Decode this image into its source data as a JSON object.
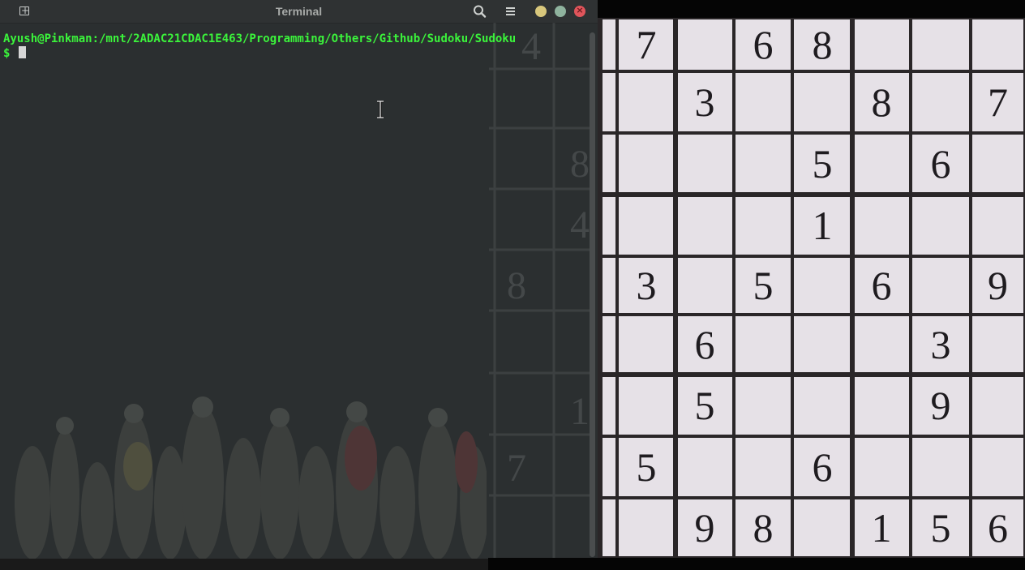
{
  "terminal": {
    "title": "Terminal",
    "prompt_path": "Ayush@Pinkman:/mnt/2ADAC21CDAC1E463/Programming/Others/Github/Sudoku/Sudoku",
    "prompt_symbol": "$",
    "icons": {
      "new_tab": "new-tab-icon",
      "search": "search-icon",
      "menu": "hamburger-menu-icon",
      "minimize": "minimize-icon",
      "maximize": "maximize-icon",
      "close": "close-icon"
    },
    "colors": {
      "prompt": "#3bf43b",
      "background": "#2b2f30",
      "close": "#e0555b",
      "minimize": "#d8c77c",
      "maximize": "#8fb39e"
    }
  },
  "background_sudoku_digits": [
    "4",
    "8",
    "4",
    "8",
    "1",
    "7"
  ],
  "sudoku_photo": {
    "rows": [
      [
        "7",
        "",
        "6",
        "8",
        "",
        "",
        ""
      ],
      [
        "",
        "3",
        "",
        "",
        "8",
        "",
        "7"
      ],
      [
        "",
        "",
        "",
        "5",
        "",
        "6",
        ""
      ],
      [
        "",
        "",
        "",
        "1",
        "",
        "",
        ""
      ],
      [
        "3",
        "",
        "5",
        "",
        "6",
        "",
        "9"
      ],
      [
        "",
        "6",
        "",
        "",
        "",
        "3",
        ""
      ],
      [
        "",
        "5",
        "",
        "",
        "",
        "9",
        ""
      ],
      [
        "5",
        "",
        "",
        "6",
        "",
        "",
        ""
      ],
      [
        "",
        "9",
        "8",
        "",
        "1",
        "5",
        "6"
      ]
    ]
  }
}
